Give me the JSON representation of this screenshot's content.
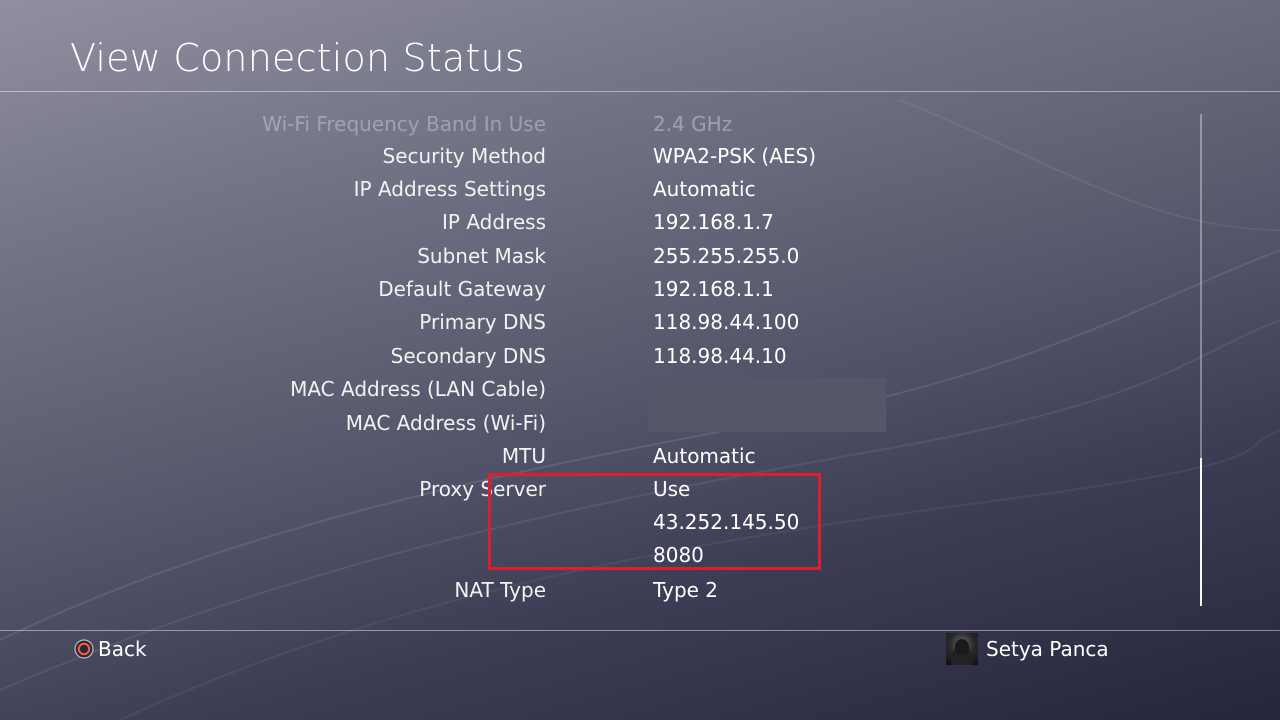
{
  "header": {
    "title": "View Connection Status"
  },
  "rows": [
    {
      "label": "Wi-Fi Frequency Band In Use",
      "value": "2.4 GHz",
      "faded": true
    },
    {
      "label": "Security Method",
      "value": "WPA2-PSK (AES)"
    },
    {
      "label": "IP Address Settings",
      "value": "Automatic"
    },
    {
      "label": "IP Address",
      "value": "192.168.1.7"
    },
    {
      "label": "Subnet Mask",
      "value": "255.255.255.0"
    },
    {
      "label": "Default Gateway",
      "value": "192.168.1.1"
    },
    {
      "label": "Primary DNS",
      "value": "118.98.44.100"
    },
    {
      "label": "Secondary DNS",
      "value": "118.98.44.10"
    },
    {
      "label": "MAC Address (LAN Cable)",
      "value": ""
    },
    {
      "label": "MAC Address (Wi-Fi)",
      "value": ""
    },
    {
      "label": "MTU",
      "value": "Automatic"
    },
    {
      "label": "Proxy Server",
      "value": "Use"
    },
    {
      "label": "",
      "value": "43.252.145.50"
    },
    {
      "label": "",
      "value": "8080"
    },
    {
      "label": "NAT Type",
      "value": "Type 2"
    }
  ],
  "scroll": {
    "visible_fraction": 0.3,
    "position_fraction": 1.0
  },
  "footer": {
    "back_label": "Back",
    "back_icon": "circle-button-icon",
    "user_name": "Setya Panca",
    "accent_color": "#e01e2b"
  }
}
